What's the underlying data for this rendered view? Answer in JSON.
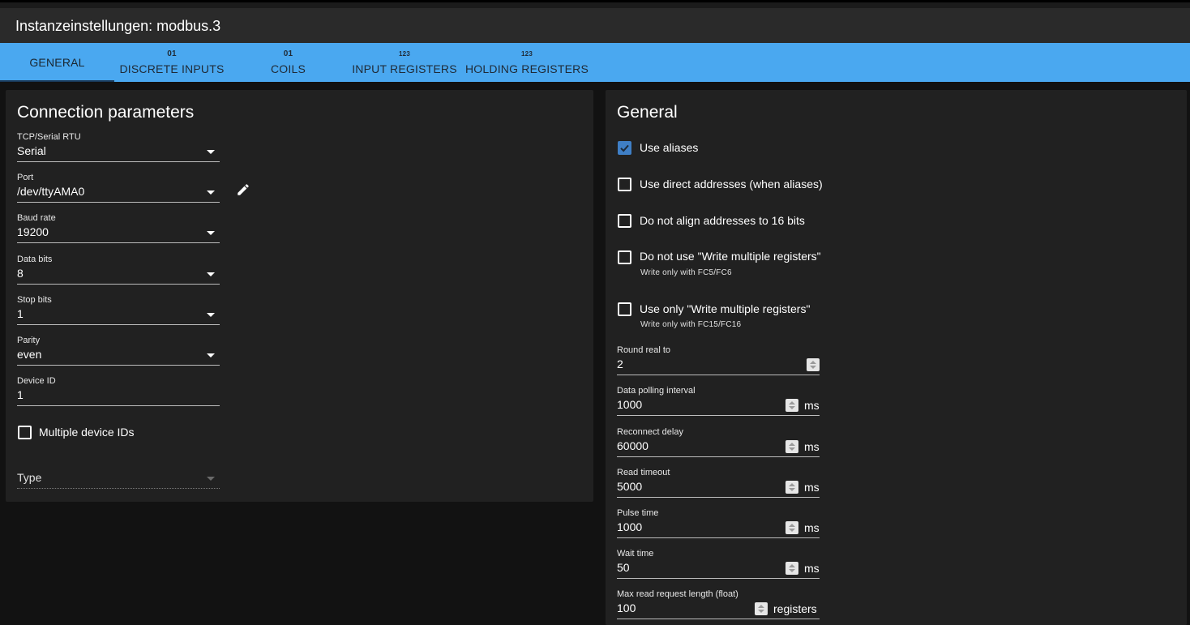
{
  "window": {
    "title": "Instanzeinstellungen: modbus.3"
  },
  "tabs": [
    {
      "icon": "",
      "label": "GENERAL",
      "active": true
    },
    {
      "icon": "01",
      "label": "DISCRETE INPUTS"
    },
    {
      "icon": "01",
      "label": "COILS"
    },
    {
      "icon": "123",
      "label": "INPUT REGISTERS"
    },
    {
      "icon": "123",
      "label": "HOLDING REGISTERS"
    }
  ],
  "connection": {
    "title": "Connection parameters",
    "tcp_serial": {
      "label": "TCP/Serial RTU",
      "value": "Serial"
    },
    "port": {
      "label": "Port",
      "value": "/dev/ttyAMA0"
    },
    "baud_rate": {
      "label": "Baud rate",
      "value": "19200"
    },
    "data_bits": {
      "label": "Data bits",
      "value": "8"
    },
    "stop_bits": {
      "label": "Stop bits",
      "value": "1"
    },
    "parity": {
      "label": "Parity",
      "value": "even"
    },
    "device_id": {
      "label": "Device ID",
      "value": "1"
    },
    "multiple_ids": {
      "label": "Multiple device IDs",
      "checked": false
    },
    "type": {
      "label": "Type"
    }
  },
  "general": {
    "title": "General",
    "use_aliases": {
      "label": "Use aliases",
      "checked": true
    },
    "use_direct": {
      "label": "Use direct addresses (when aliases)",
      "checked": false
    },
    "no_align": {
      "label": "Do not align addresses to 16 bits",
      "checked": false
    },
    "no_write_multiple": {
      "label": "Do not use \"Write multiple registers\"",
      "help": "Write only with FC5/FC6",
      "checked": false
    },
    "only_write_multiple": {
      "label": "Use only \"Write multiple registers\"",
      "help": "Write only with FC15/FC16",
      "checked": false
    },
    "round_real": {
      "label": "Round real to",
      "value": "2"
    },
    "poll": {
      "label": "Data polling interval",
      "value": "1000",
      "unit": "ms"
    },
    "recon": {
      "label": "Reconnect delay",
      "value": "60000",
      "unit": "ms"
    },
    "read_timeout": {
      "label": "Read timeout",
      "value": "5000",
      "unit": "ms"
    },
    "pulse": {
      "label": "Pulse time",
      "value": "1000",
      "unit": "ms"
    },
    "wait": {
      "label": "Wait time",
      "value": "50",
      "unit": "ms"
    },
    "max_read": {
      "label": "Max read request length (float)",
      "value": "100",
      "unit": "registers"
    }
  },
  "colors": {
    "tab_bar": "#4aa8f0",
    "checkbox_checked": "#3f7fc6",
    "panel": "#212121",
    "background": "#121212"
  }
}
